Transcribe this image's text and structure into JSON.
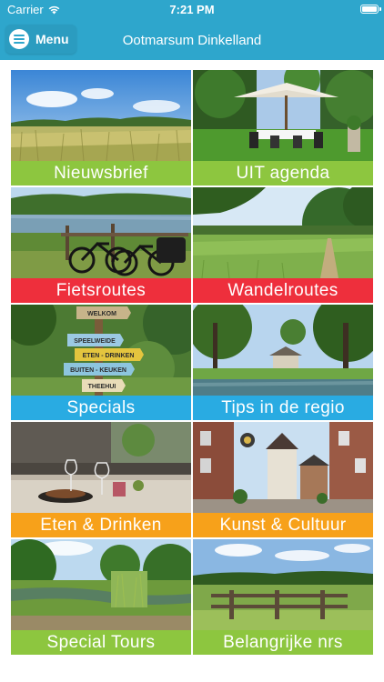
{
  "status_bar": {
    "carrier": "Carrier",
    "time": "7:21 PM",
    "wifi_icon": "wifi-icon",
    "battery_icon": "battery-icon"
  },
  "header": {
    "menu_label": "Menu",
    "menu_icon": "hamburger-menu-icon",
    "title": "Ootmarsum Dinkelland",
    "background_color": "#2ea6cc"
  },
  "tiles": [
    {
      "label": "Nieuwsbrief",
      "color": "#8dc63f",
      "image": "grass-field-photo"
    },
    {
      "label": "UIT agenda",
      "color": "#8dc63f",
      "image": "garden-terrace-umbrella-photo"
    },
    {
      "label": "Fietsroutes",
      "color": "#ee2f3c",
      "image": "bicycles-by-river-photo"
    },
    {
      "label": "Wandelroutes",
      "color": "#ee2f3c",
      "image": "meadow-path-trees-photo"
    },
    {
      "label": "Specials",
      "color": "#29abe2",
      "image": "wooden-signpost-photo"
    },
    {
      "label": "Tips in de regio",
      "color": "#29abe2",
      "image": "country-estate-pond-photo"
    },
    {
      "label": "Eten & Drinken",
      "color": "#f7a11a",
      "image": "restaurant-table-photo"
    },
    {
      "label": "Kunst & Cultuur",
      "color": "#f7a11a",
      "image": "village-street-photo"
    },
    {
      "label": "Special Tours",
      "color": "#8dc63f",
      "image": "stream-woodland-photo"
    },
    {
      "label": "Belangrijke nrs",
      "color": "#8dc63f",
      "image": "fence-pasture-photo"
    }
  ],
  "signpost": {
    "sign_1": "WELKOM",
    "sign_2": "SPEELWEIDE",
    "sign_3": "ETEN - DRINKEN",
    "sign_4": "BUITEN - KEUKEN",
    "sign_5": "THEEHUI"
  }
}
